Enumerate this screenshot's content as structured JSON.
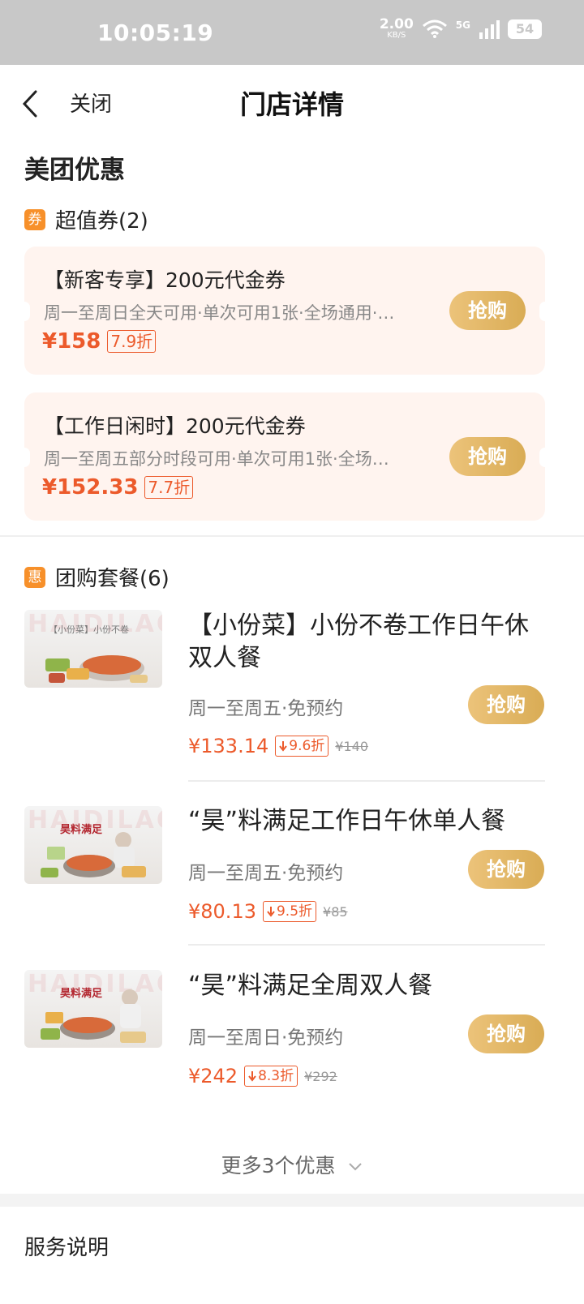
{
  "status": {
    "time": "10:05:19",
    "net_speed": "2.00",
    "net_unit": "KB/S",
    "network": "5G",
    "battery": "54"
  },
  "nav": {
    "close_label": "关闭",
    "title": "门店详情"
  },
  "offers": {
    "section_title": "美团优惠",
    "coupon_heading": "超值券(2)",
    "coupon_tag": "券",
    "coupons": [
      {
        "title": "【新客专享】200元代金券",
        "desc": "周一至周日全天可用·单次可用1张·全场通用·…",
        "price": "¥158",
        "discount": "7.9折",
        "buy_label": "抢购"
      },
      {
        "title": "【工作日闲时】200元代金券",
        "desc": "周一至周五部分时段可用·单次可用1张·全场…",
        "price": "¥152.33",
        "discount": "7.7折",
        "buy_label": "抢购"
      }
    ]
  },
  "group": {
    "heading": "团购套餐(6)",
    "tag": "惠",
    "deals": [
      {
        "title": "【小份菜】小份不卷工作日午休双人餐",
        "desc": "周一至周五·免预约",
        "price": "¥133.14",
        "discount": "9.6折",
        "original": "¥140",
        "buy_label": "抢购",
        "img_caption": "【小份菜】小份不卷"
      },
      {
        "title": "“昊”料满足工作日午休单人餐",
        "desc": "周一至周五·免预约",
        "price": "¥80.13",
        "discount": "9.5折",
        "original": "¥85",
        "buy_label": "抢购",
        "img_caption": "昊料满足"
      },
      {
        "title": "“昊”料满足全周双人餐",
        "desc": "周一至周日·免预约",
        "price": "¥242",
        "discount": "8.3折",
        "original": "¥292",
        "buy_label": "抢购",
        "img_caption": "昊料满足"
      }
    ],
    "more_label": "更多3个优惠"
  },
  "service": {
    "heading": "服务说明"
  },
  "colors": {
    "accent": "#ec5a2b",
    "tag_orange": "#f7902a",
    "button_gold": "#ddb15c",
    "coupon_bg": "#fff4ef"
  },
  "img_watermark": "HAIDILAO"
}
